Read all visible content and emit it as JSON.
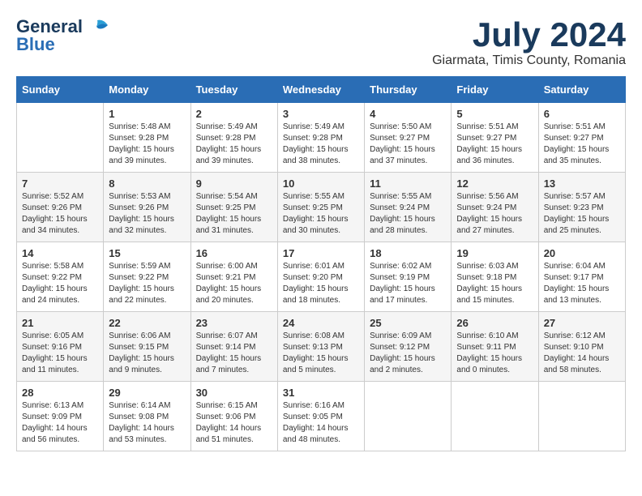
{
  "logo": {
    "line1": "General",
    "line2": "Blue"
  },
  "header": {
    "month": "July 2024",
    "location": "Giarmata, Timis County, Romania"
  },
  "days_of_week": [
    "Sunday",
    "Monday",
    "Tuesday",
    "Wednesday",
    "Thursday",
    "Friday",
    "Saturday"
  ],
  "weeks": [
    [
      {
        "day": "",
        "info": ""
      },
      {
        "day": "1",
        "info": "Sunrise: 5:48 AM\nSunset: 9:28 PM\nDaylight: 15 hours\nand 39 minutes."
      },
      {
        "day": "2",
        "info": "Sunrise: 5:49 AM\nSunset: 9:28 PM\nDaylight: 15 hours\nand 39 minutes."
      },
      {
        "day": "3",
        "info": "Sunrise: 5:49 AM\nSunset: 9:28 PM\nDaylight: 15 hours\nand 38 minutes."
      },
      {
        "day": "4",
        "info": "Sunrise: 5:50 AM\nSunset: 9:27 PM\nDaylight: 15 hours\nand 37 minutes."
      },
      {
        "day": "5",
        "info": "Sunrise: 5:51 AM\nSunset: 9:27 PM\nDaylight: 15 hours\nand 36 minutes."
      },
      {
        "day": "6",
        "info": "Sunrise: 5:51 AM\nSunset: 9:27 PM\nDaylight: 15 hours\nand 35 minutes."
      }
    ],
    [
      {
        "day": "7",
        "info": "Sunrise: 5:52 AM\nSunset: 9:26 PM\nDaylight: 15 hours\nand 34 minutes."
      },
      {
        "day": "8",
        "info": "Sunrise: 5:53 AM\nSunset: 9:26 PM\nDaylight: 15 hours\nand 32 minutes."
      },
      {
        "day": "9",
        "info": "Sunrise: 5:54 AM\nSunset: 9:25 PM\nDaylight: 15 hours\nand 31 minutes."
      },
      {
        "day": "10",
        "info": "Sunrise: 5:55 AM\nSunset: 9:25 PM\nDaylight: 15 hours\nand 30 minutes."
      },
      {
        "day": "11",
        "info": "Sunrise: 5:55 AM\nSunset: 9:24 PM\nDaylight: 15 hours\nand 28 minutes."
      },
      {
        "day": "12",
        "info": "Sunrise: 5:56 AM\nSunset: 9:24 PM\nDaylight: 15 hours\nand 27 minutes."
      },
      {
        "day": "13",
        "info": "Sunrise: 5:57 AM\nSunset: 9:23 PM\nDaylight: 15 hours\nand 25 minutes."
      }
    ],
    [
      {
        "day": "14",
        "info": "Sunrise: 5:58 AM\nSunset: 9:22 PM\nDaylight: 15 hours\nand 24 minutes."
      },
      {
        "day": "15",
        "info": "Sunrise: 5:59 AM\nSunset: 9:22 PM\nDaylight: 15 hours\nand 22 minutes."
      },
      {
        "day": "16",
        "info": "Sunrise: 6:00 AM\nSunset: 9:21 PM\nDaylight: 15 hours\nand 20 minutes."
      },
      {
        "day": "17",
        "info": "Sunrise: 6:01 AM\nSunset: 9:20 PM\nDaylight: 15 hours\nand 18 minutes."
      },
      {
        "day": "18",
        "info": "Sunrise: 6:02 AM\nSunset: 9:19 PM\nDaylight: 15 hours\nand 17 minutes."
      },
      {
        "day": "19",
        "info": "Sunrise: 6:03 AM\nSunset: 9:18 PM\nDaylight: 15 hours\nand 15 minutes."
      },
      {
        "day": "20",
        "info": "Sunrise: 6:04 AM\nSunset: 9:17 PM\nDaylight: 15 hours\nand 13 minutes."
      }
    ],
    [
      {
        "day": "21",
        "info": "Sunrise: 6:05 AM\nSunset: 9:16 PM\nDaylight: 15 hours\nand 11 minutes."
      },
      {
        "day": "22",
        "info": "Sunrise: 6:06 AM\nSunset: 9:15 PM\nDaylight: 15 hours\nand 9 minutes."
      },
      {
        "day": "23",
        "info": "Sunrise: 6:07 AM\nSunset: 9:14 PM\nDaylight: 15 hours\nand 7 minutes."
      },
      {
        "day": "24",
        "info": "Sunrise: 6:08 AM\nSunset: 9:13 PM\nDaylight: 15 hours\nand 5 minutes."
      },
      {
        "day": "25",
        "info": "Sunrise: 6:09 AM\nSunset: 9:12 PM\nDaylight: 15 hours\nand 2 minutes."
      },
      {
        "day": "26",
        "info": "Sunrise: 6:10 AM\nSunset: 9:11 PM\nDaylight: 15 hours\nand 0 minutes."
      },
      {
        "day": "27",
        "info": "Sunrise: 6:12 AM\nSunset: 9:10 PM\nDaylight: 14 hours\nand 58 minutes."
      }
    ],
    [
      {
        "day": "28",
        "info": "Sunrise: 6:13 AM\nSunset: 9:09 PM\nDaylight: 14 hours\nand 56 minutes."
      },
      {
        "day": "29",
        "info": "Sunrise: 6:14 AM\nSunset: 9:08 PM\nDaylight: 14 hours\nand 53 minutes."
      },
      {
        "day": "30",
        "info": "Sunrise: 6:15 AM\nSunset: 9:06 PM\nDaylight: 14 hours\nand 51 minutes."
      },
      {
        "day": "31",
        "info": "Sunrise: 6:16 AM\nSunset: 9:05 PM\nDaylight: 14 hours\nand 48 minutes."
      },
      {
        "day": "",
        "info": ""
      },
      {
        "day": "",
        "info": ""
      },
      {
        "day": "",
        "info": ""
      }
    ]
  ]
}
